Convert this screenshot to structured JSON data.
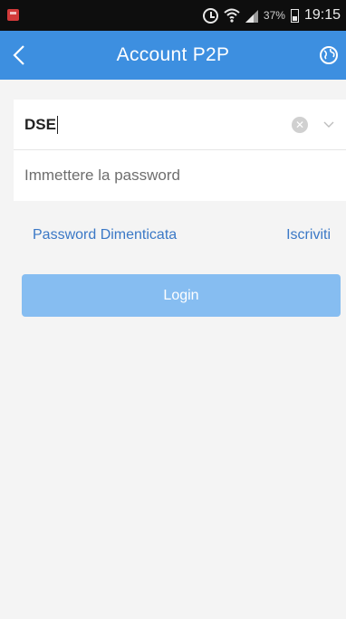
{
  "status_bar": {
    "battery_percent": "37%",
    "time": "19:15",
    "icons": [
      "notification-icon",
      "alarm-icon",
      "wifi-icon",
      "signal-icon",
      "battery-icon"
    ]
  },
  "header": {
    "title": "Account P2P",
    "back_icon": "chevron-left-icon",
    "globe_icon": "globe-icon",
    "background": "#3d8fe0"
  },
  "form": {
    "username_value": "DSE",
    "password_placeholder": "Immettere la password",
    "clear_icon": "clear-icon",
    "dropdown_icon": "chevron-down-icon"
  },
  "links": {
    "forgot_password": "Password Dimenticata",
    "register": "Iscriviti"
  },
  "login": {
    "label": "Login",
    "color": "#86bdf1"
  }
}
